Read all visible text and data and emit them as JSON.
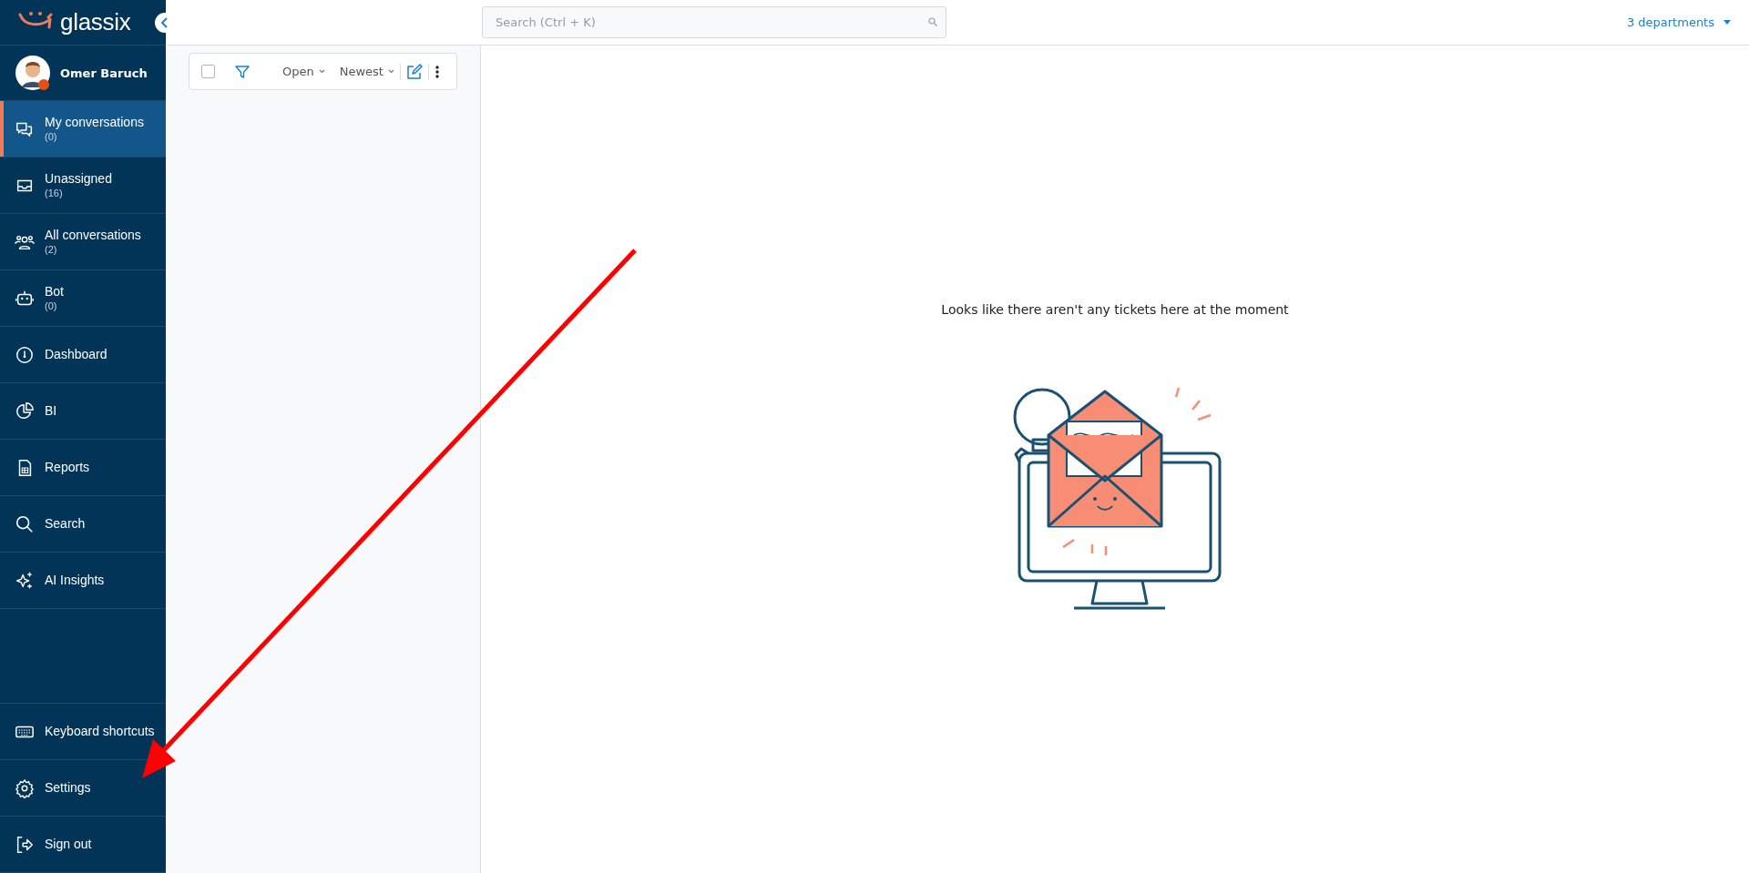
{
  "sidebar": {
    "logo": "glassix",
    "user": {
      "name": "Omer Baruch"
    },
    "items": [
      {
        "label": "My conversations",
        "count": "(0)",
        "selected": true
      },
      {
        "label": "Unassigned",
        "count": "(16)",
        "selected": false
      },
      {
        "label": "All conversations",
        "count": "(2)",
        "selected": false
      },
      {
        "label": "Bot",
        "count": "(0)",
        "selected": false
      },
      {
        "label": "Dashboard",
        "selected": false
      },
      {
        "label": "BI",
        "selected": false
      },
      {
        "label": "Reports",
        "selected": false
      },
      {
        "label": "Search",
        "selected": false
      },
      {
        "label": "AI Insights",
        "selected": false
      }
    ],
    "bottom_items": [
      {
        "label": "Keyboard shortcuts",
        "selected": false
      },
      {
        "label": "Settings",
        "selected": false
      },
      {
        "label": "Sign out",
        "selected": false
      }
    ]
  },
  "search": {
    "placeholder": "Search (Ctrl + K)"
  },
  "departments": "3 departments",
  "toolbar": {
    "select_all": {
      "checked": false
    },
    "status": "Open",
    "sort": "Newest"
  },
  "empty_message": "Looks like there aren't any tickets here at the moment"
}
